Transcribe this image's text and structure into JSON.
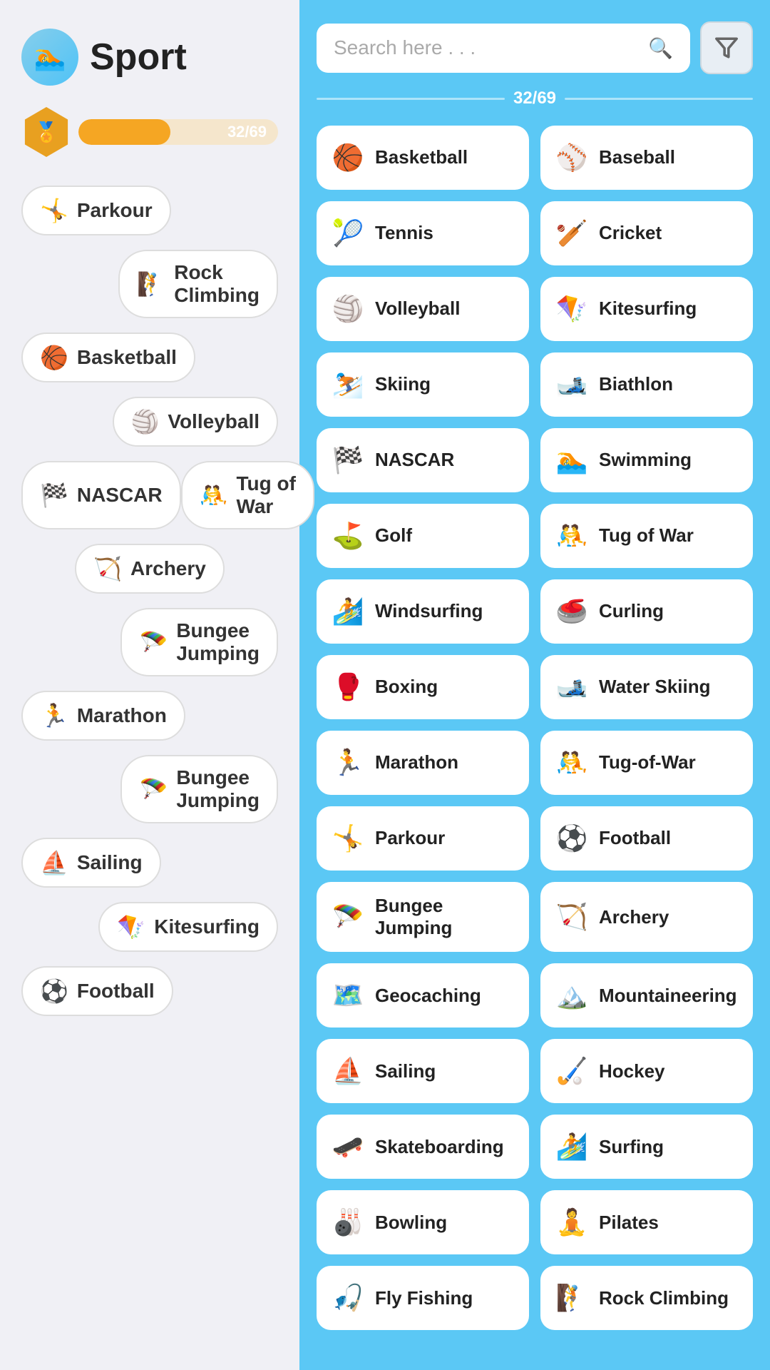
{
  "header": {
    "icon": "🏊",
    "title": "Sport"
  },
  "progress": {
    "badge_icon": "🏅",
    "current": 32,
    "total": 69,
    "label": "32/69",
    "percent": 46
  },
  "left_chips": [
    {
      "id": "parkour",
      "icon": "🤸",
      "label": "Parkour",
      "align": "left"
    },
    {
      "id": "rock-climbing",
      "icon": "🧗",
      "label": "Rock Climbing",
      "align": "right"
    },
    {
      "id": "basketball",
      "icon": "🏀",
      "label": "Basketball",
      "align": "left"
    },
    {
      "id": "volleyball",
      "icon": "🏐",
      "label": "Volleyball",
      "align": "right"
    },
    {
      "id": "nascar",
      "icon": "🏁",
      "label": "NASCAR",
      "align": "left"
    },
    {
      "id": "tug-of-war",
      "icon": "🤼",
      "label": "Tug of War",
      "align": "right"
    },
    {
      "id": "archery",
      "icon": "🏹",
      "label": "Archery",
      "align": "center"
    },
    {
      "id": "bungee-jumping-1",
      "icon": "🪂",
      "label": "Bungee Jumping",
      "align": "right"
    },
    {
      "id": "marathon",
      "icon": "🏃",
      "label": "Marathon",
      "align": "left"
    },
    {
      "id": "bungee-jumping-2",
      "icon": "🪂",
      "label": "Bungee Jumping",
      "align": "right"
    },
    {
      "id": "sailing",
      "icon": "⛵",
      "label": "Sailing",
      "align": "left"
    },
    {
      "id": "kitesurfing",
      "icon": "🪁",
      "label": "Kitesurfing",
      "align": "right"
    },
    {
      "id": "football",
      "icon": "⚽",
      "label": "Football",
      "align": "left"
    }
  ],
  "search": {
    "placeholder": "Search here . . .",
    "icon": "🔍"
  },
  "filter_icon": "⧩",
  "progress_indicator": {
    "label": "32/69"
  },
  "right_cards": [
    {
      "id": "basketball",
      "icon": "🏀",
      "label": "Basketball"
    },
    {
      "id": "baseball",
      "icon": "⚾",
      "label": "Baseball"
    },
    {
      "id": "tennis",
      "icon": "🎾",
      "label": "Tennis"
    },
    {
      "id": "cricket",
      "icon": "🏏",
      "label": "Cricket"
    },
    {
      "id": "volleyball",
      "icon": "🏐",
      "label": "Volleyball"
    },
    {
      "id": "kitesurfing",
      "icon": "🪁",
      "label": "Kitesurfing"
    },
    {
      "id": "skiing",
      "icon": "⛷️",
      "label": "Skiing"
    },
    {
      "id": "biathlon",
      "icon": "🎿",
      "label": "Biathlon"
    },
    {
      "id": "nascar",
      "icon": "🏁",
      "label": "NASCAR"
    },
    {
      "id": "swimming",
      "icon": "🏊",
      "label": "Swimming"
    },
    {
      "id": "golf",
      "icon": "⛳",
      "label": "Golf"
    },
    {
      "id": "tug-of-war",
      "icon": "🤼",
      "label": "Tug of War"
    },
    {
      "id": "windsurfing",
      "icon": "🏄",
      "label": "Windsurfing"
    },
    {
      "id": "curling",
      "icon": "🥌",
      "label": "Curling"
    },
    {
      "id": "boxing",
      "icon": "🥊",
      "label": "Boxing"
    },
    {
      "id": "water-skiing",
      "icon": "🎿",
      "label": "Water Skiing"
    },
    {
      "id": "marathon",
      "icon": "🏃",
      "label": "Marathon"
    },
    {
      "id": "tug-of-war-2",
      "icon": "🤼",
      "label": "Tug-of-War"
    },
    {
      "id": "parkour",
      "icon": "🤸",
      "label": "Parkour"
    },
    {
      "id": "football",
      "icon": "⚽",
      "label": "Football"
    },
    {
      "id": "bungee-jumping",
      "icon": "🪂",
      "label": "Bungee Jumping"
    },
    {
      "id": "archery",
      "icon": "🏹",
      "label": "Archery"
    },
    {
      "id": "geocaching",
      "icon": "🗺️",
      "label": "Geocaching"
    },
    {
      "id": "mountaineering",
      "icon": "🏔️",
      "label": "Mountaineering"
    },
    {
      "id": "sailing",
      "icon": "⛵",
      "label": "Sailing"
    },
    {
      "id": "hockey",
      "icon": "🏑",
      "label": "Hockey"
    },
    {
      "id": "skateboarding",
      "icon": "🛹",
      "label": "Skateboarding"
    },
    {
      "id": "surfing",
      "icon": "🏄",
      "label": "Surfing"
    },
    {
      "id": "bowling",
      "icon": "🎳",
      "label": "Bowling"
    },
    {
      "id": "pilates",
      "icon": "🧘",
      "label": "Pilates"
    },
    {
      "id": "fly-fishing",
      "icon": "🎣",
      "label": "Fly Fishing"
    },
    {
      "id": "rock-climbing",
      "icon": "🧗",
      "label": "Rock Climbing"
    }
  ]
}
